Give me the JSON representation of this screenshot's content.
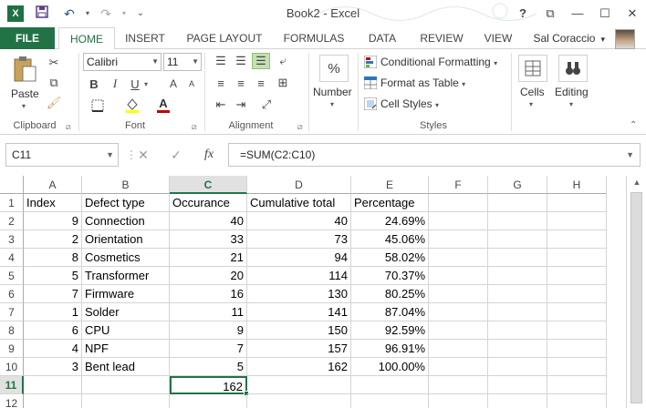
{
  "app": {
    "title": "Book2 - Excel",
    "logo": "X",
    "help": "?",
    "restore_ribbon": "⧉",
    "minimize": "—",
    "maximize": "☐",
    "close": "✕"
  },
  "tabs": [
    "FILE",
    "HOME",
    "INSERT",
    "PAGE LAYOUT",
    "FORMULAS",
    "DATA",
    "REVIEW",
    "VIEW"
  ],
  "user": {
    "name": "Sal Coraccio"
  },
  "ribbon": {
    "clipboard": {
      "paste_label": "Paste",
      "group_label": "Clipboard"
    },
    "font": {
      "family": "Calibri",
      "size": "11",
      "bold": "B",
      "italic": "I",
      "underline": "U",
      "group_label": "Font",
      "color_a": "A",
      "grow": "A",
      "shrink": "A"
    },
    "alignment": {
      "group_label": "Alignment"
    },
    "number": {
      "percent": "%",
      "label": "Number"
    },
    "styles": {
      "conditional": "Conditional Formatting",
      "format_table": "Format as Table",
      "cell_styles": "Cell Styles",
      "group_label": "Styles"
    },
    "cells": {
      "label": "Cells"
    },
    "editing": {
      "label": "Editing"
    },
    "accent": "#217346"
  },
  "formula_bar": {
    "name_box": "C11",
    "cancel": "✕",
    "enter": "✓",
    "fx": "fx",
    "formula": "=SUM(C2:C10)"
  },
  "sheet": {
    "columns": [
      "A",
      "B",
      "C",
      "D",
      "E",
      "F",
      "G",
      "H"
    ],
    "selected_column": "C",
    "selected_row": "11",
    "rows": [
      {
        "n": "1",
        "A": "Index",
        "B": "Defect type",
        "C": "Occurance",
        "D": "Cumulative total",
        "E": "Percentage"
      },
      {
        "n": "2",
        "A": "9",
        "B": "Connection",
        "C": "40",
        "D": "40",
        "E": "24.69%"
      },
      {
        "n": "3",
        "A": "2",
        "B": "Orientation",
        "C": "33",
        "D": "73",
        "E": "45.06%"
      },
      {
        "n": "4",
        "A": "8",
        "B": "Cosmetics",
        "C": "21",
        "D": "94",
        "E": "58.02%"
      },
      {
        "n": "5",
        "A": "5",
        "B": "Transformer",
        "C": "20",
        "D": "114",
        "E": "70.37%"
      },
      {
        "n": "6",
        "A": "7",
        "B": "Firmware",
        "C": "16",
        "D": "130",
        "E": "80.25%"
      },
      {
        "n": "7",
        "A": "1",
        "B": "Solder",
        "C": "11",
        "D": "141",
        "E": "87.04%"
      },
      {
        "n": "8",
        "A": "6",
        "B": "CPU",
        "C": "9",
        "D": "150",
        "E": "92.59%"
      },
      {
        "n": "9",
        "A": "4",
        "B": "NPF",
        "C": "7",
        "D": "157",
        "E": "96.91%"
      },
      {
        "n": "10",
        "A": "3",
        "B": "Bent lead",
        "C": "5",
        "D": "162",
        "E": "100.00%"
      },
      {
        "n": "11",
        "A": "",
        "B": "",
        "C": "162",
        "D": "",
        "E": ""
      },
      {
        "n": "12",
        "A": "",
        "B": "",
        "C": "",
        "D": "",
        "E": ""
      }
    ]
  }
}
